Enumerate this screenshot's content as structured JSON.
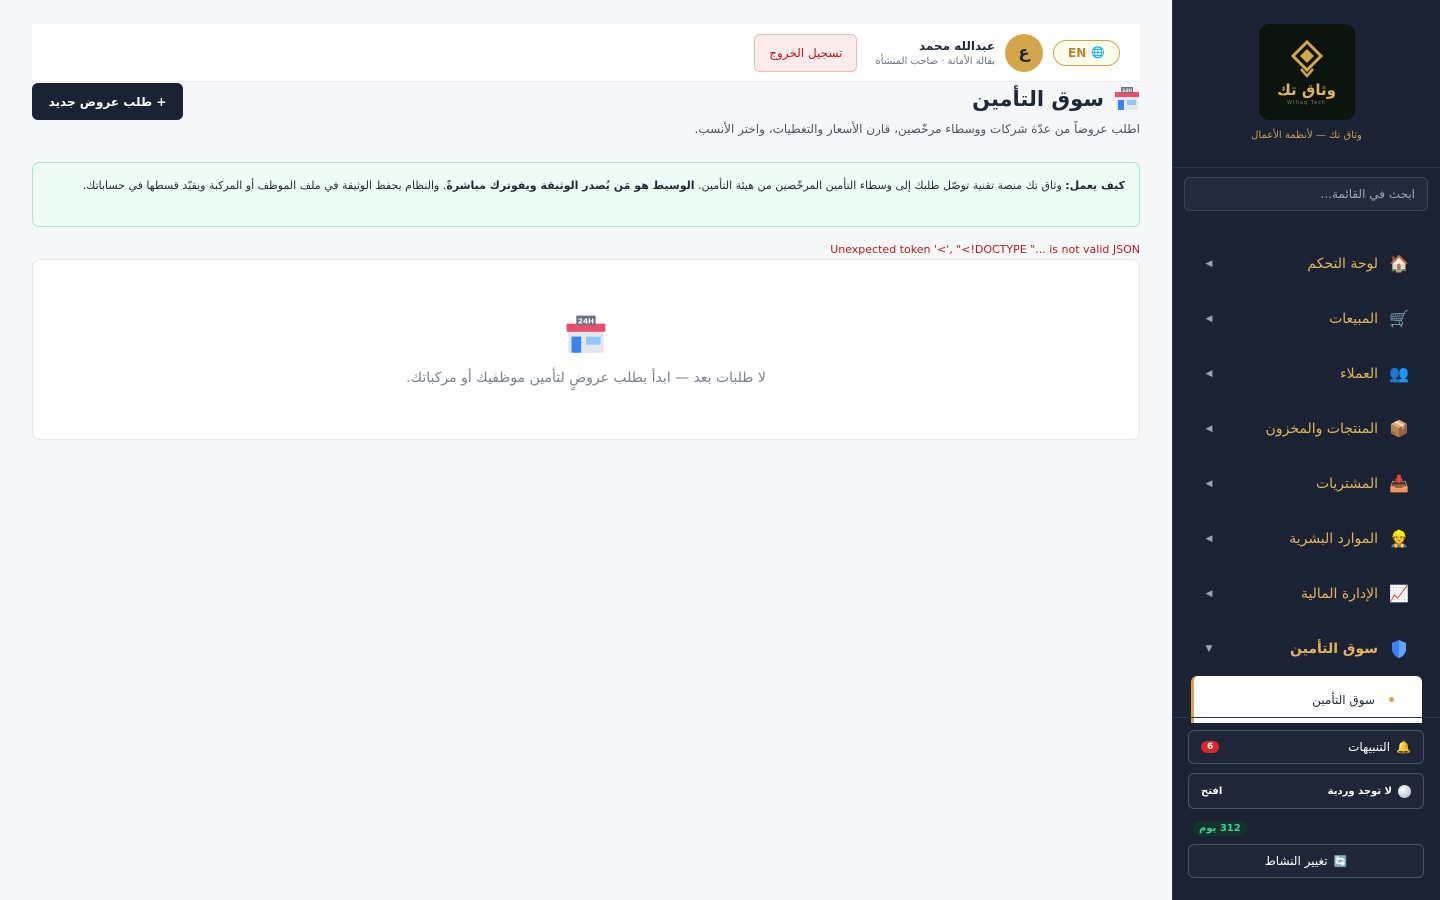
{
  "sidebar": {
    "logo_text": "وثاق تك",
    "logo_sub": "Wthaq Tech",
    "tagline": "وثاق تك — لأنظمة الأعمال",
    "search_placeholder": "ابحث في القائمة...",
    "items": [
      {
        "label": "لوحة التحكم",
        "icon": "house-icon",
        "glyph": "🏠"
      },
      {
        "label": "المبيعات",
        "icon": "cart-icon",
        "glyph": "🛒"
      },
      {
        "label": "العملاء",
        "icon": "users-icon",
        "glyph": "👥"
      },
      {
        "label": "المنتجات والمخزون",
        "icon": "package-icon",
        "glyph": "📦"
      },
      {
        "label": "المشتريات",
        "icon": "inbox-icon",
        "glyph": "📥"
      },
      {
        "label": "الموارد البشرية",
        "icon": "person-icon",
        "glyph": "👷"
      },
      {
        "label": "الإدارة المالية",
        "icon": "chart-icon",
        "glyph": "📈"
      },
      {
        "label": "سوق التأمين",
        "icon": "shield-icon",
        "glyph": "🛡"
      }
    ],
    "sub_item": "سوق التأمين",
    "alerts_label": "التنبيهات",
    "alerts_count": "6",
    "shift_label": "لا توجد وردية",
    "open_label": "افتح",
    "days_label": "312 يوم",
    "switch_label": "تغيير النشاط"
  },
  "topbar": {
    "logout_label": "تسجيل الخروج",
    "user_name": "عبدالله محمد",
    "user_role": "بقالة الأمانة · صاحب المنشأة",
    "avatar_letter": "ع",
    "lang_label": "EN"
  },
  "page": {
    "title": "سوق التأمين",
    "subtitle": "اطلب عروضاً من عدّة شركات ووسطاء مرخّصين، قارن الأسعار والتغطيات، واختر الأنسب.",
    "new_button": "+ طلب عروض جديد",
    "info_prefix": "كيف يعمل:",
    "info_part1": " وثاق تك منصة تقنية توصّل طلبك إلى وسطاء التأمين المرخّصين من هيئة التأمين. ",
    "info_bold": "الوسيط هو مَن يُصدر الوثيقة ويفوترك مباشرةً",
    "info_part2": ". والنظام يحفظ الوثيقة في ملف الموظف أو المركبة ويقيّد قسطها في حساباتك.",
    "error_text": "Unexpected token '<', \"<!DOCTYPE \"... is not valid JSON",
    "empty_text": "لا طلبات بعد — ابدأ بطلب عروضٍ لتأمين موظفيك أو مركباتك."
  }
}
